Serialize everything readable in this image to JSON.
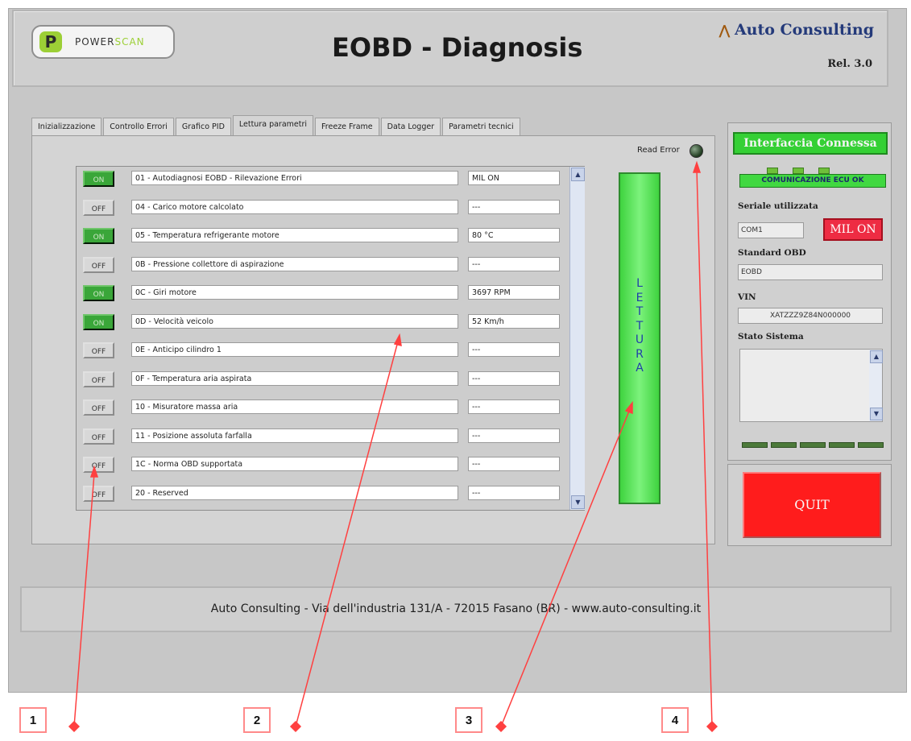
{
  "header": {
    "logo_text_a": "POWER",
    "logo_text_b": "SCAN",
    "title": "EOBD - Diagnosis",
    "brand": "Auto Consulting",
    "release": "Rel. 3.0"
  },
  "tabs": [
    {
      "label": "Inizializzazione"
    },
    {
      "label": "Controllo Errori"
    },
    {
      "label": "Grafico PID"
    },
    {
      "label": "Lettura parametri"
    },
    {
      "label": "Freeze Frame"
    },
    {
      "label": "Data Logger"
    },
    {
      "label": "Parametri tecnici"
    }
  ],
  "read_error_label": "Read Error",
  "rows": [
    {
      "state": "ON",
      "desc": "01 - Autodiagnosi EOBD - Rilevazione Errori",
      "value": "MIL ON"
    },
    {
      "state": "OFF",
      "desc": "04 - Carico motore calcolato",
      "value": "---"
    },
    {
      "state": "ON",
      "desc": "05 - Temperatura refrigerante motore",
      "value": "80 °C"
    },
    {
      "state": "OFF",
      "desc": "0B - Pressione collettore di aspirazione",
      "value": "---"
    },
    {
      "state": "ON",
      "desc": "0C - Giri motore",
      "value": "3697 RPM"
    },
    {
      "state": "ON",
      "desc": "0D - Velocità veicolo",
      "value": "52 Km/h"
    },
    {
      "state": "OFF",
      "desc": "0E - Anticipo cilindro 1",
      "value": "---"
    },
    {
      "state": "OFF",
      "desc": "0F - Temperatura aria aspirata",
      "value": "---"
    },
    {
      "state": "OFF",
      "desc": "10 - Misuratore massa aria",
      "value": "---"
    },
    {
      "state": "OFF",
      "desc": "11 - Posizione assoluta farfalla",
      "value": "---"
    },
    {
      "state": "OFF",
      "desc": "1C - Norma OBD supportata",
      "value": "---"
    },
    {
      "state": "OFF",
      "desc": "20 - Reserved",
      "value": "---"
    }
  ],
  "lettura_label": "L\nE\nT\nT\nU\nR\nA",
  "side": {
    "connection": "Interfaccia Connessa",
    "comm_status": "COMUNICAZIONE ECU OK",
    "serial_label": "Seriale utilizzata",
    "serial_value": "COM1",
    "mil_label": "MIL ON",
    "standard_label": "Standard OBD",
    "standard_value": "EOBD",
    "vin_label": "VIN",
    "vin_value": "XATZZZ9Z84N000000",
    "stato_label": "Stato Sistema",
    "stato_value": ""
  },
  "quit_label": "QUIT",
  "footer": "Auto Consulting - Via dell'industria 131/A - 72015 Fasano (BR) - www.auto-consulting.it",
  "callouts": [
    "1",
    "2",
    "3",
    "4"
  ],
  "colors": {
    "on_green": "#3aa639",
    "lettura_green": "#5fe85f",
    "mil_red": "#ee2c43",
    "quit_red": "#ff1c1c",
    "annotation_red": "#ff4040"
  }
}
